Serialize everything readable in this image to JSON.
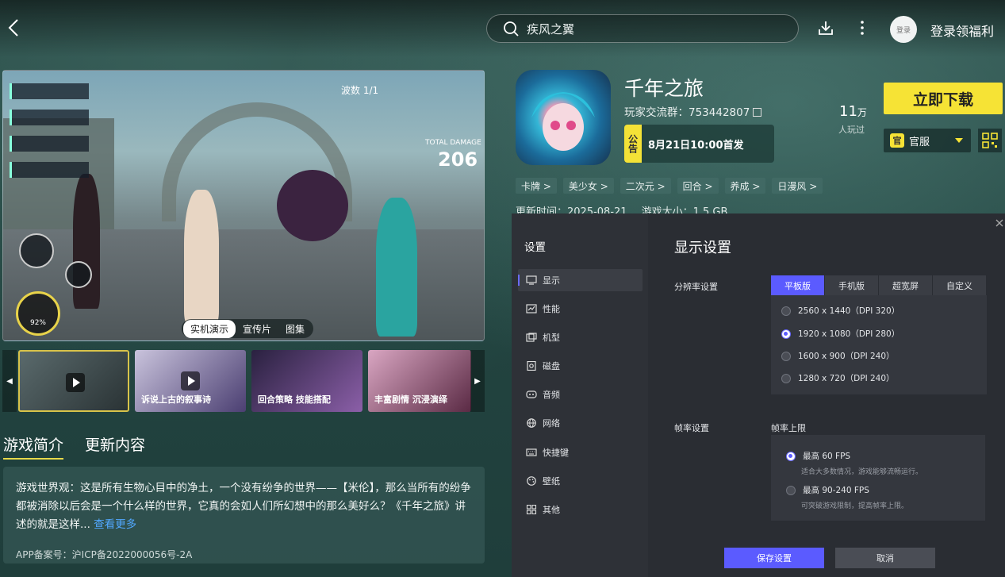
{
  "topbar": {
    "search_placeholder": "疾风之翼",
    "login_avatar": "登录",
    "login_text": "登录领福利"
  },
  "media": {
    "wave_label": "波数",
    "wave_value": "1/1",
    "total_damage_label": "TOTAL DAMAGE",
    "total_damage_value": "206",
    "energy_percent": "92%",
    "tabs": [
      "实机演示",
      "宣传片",
      "图集"
    ],
    "active_tab": 0
  },
  "thumbnails": [
    {
      "caption": "",
      "video": true,
      "selected": true
    },
    {
      "caption": "诉说上古的叙事诗",
      "video": true,
      "selected": false
    },
    {
      "caption": "回合策略 技能搭配",
      "video": false,
      "selected": false
    },
    {
      "caption": "丰富剧情 沉浸演绎",
      "video": false,
      "selected": false
    }
  ],
  "intro": {
    "tabs": [
      "游戏简介",
      "更新内容"
    ],
    "text": "游戏世界观：这是所有生物心目中的净土，一个没有纷争的世界——【米伦】，那么当所有的纷争都被消除以后会是一个什么样的世界，它真的会如人们所幻想中的那么美好么？《千年之旅》讲述的就是这样...",
    "see_more": "查看更多",
    "icp": "APP备案号：沪ICP备2022000056号-2A"
  },
  "game": {
    "title": "千年之旅",
    "group": "玩家交流群：753442807",
    "notice_badge": "公告",
    "notice_text": "8月21日10:00首发",
    "players_num": "11",
    "players_unit": "万",
    "players_label": "人玩过",
    "download_label": "立即下载",
    "server_icon": "官",
    "server_label": "官服",
    "tags": [
      "卡牌 >",
      "美少女 >",
      "二次元 >",
      "回合 >",
      "养成 >",
      "日漫风 >"
    ],
    "update_time": "更新时间：2025-08-21",
    "size": "游戏大小：1.5 GB"
  },
  "settings": {
    "sidebar_title": "设置",
    "nav": [
      {
        "label": "显示",
        "icon": "monitor-icon"
      },
      {
        "label": "性能",
        "icon": "performance-icon"
      },
      {
        "label": "机型",
        "icon": "device-icon"
      },
      {
        "label": "磁盘",
        "icon": "disk-icon"
      },
      {
        "label": "音频",
        "icon": "audio-icon"
      },
      {
        "label": "网络",
        "icon": "network-icon"
      },
      {
        "label": "快捷键",
        "icon": "keyboard-icon"
      },
      {
        "label": "壁纸",
        "icon": "wallpaper-icon"
      },
      {
        "label": "其他",
        "icon": "other-icon"
      }
    ],
    "active_nav": 0,
    "title": "显示设置",
    "resolution_label": "分辨率设置",
    "resolution_tabs": [
      "平板版",
      "手机版",
      "超宽屏",
      "自定义"
    ],
    "active_resolution_tab": 0,
    "resolutions": [
      {
        "label": "2560 x 1440（DPI 320）",
        "selected": false
      },
      {
        "label": "1920 x 1080（DPI 280）",
        "selected": true
      },
      {
        "label": "1600 x 900（DPI 240）",
        "selected": false
      },
      {
        "label": "1280 x 720（DPI 240）",
        "selected": false
      }
    ],
    "fps_label": "帧率设置",
    "fps_limit_label": "帧率上限",
    "fps_options": [
      {
        "label": "最高 60 FPS",
        "desc": "适合大多数情况，游戏能够流畅运行。",
        "selected": true
      },
      {
        "label": "最高 90-240 FPS",
        "desc": "可突破游戏限制，提高帧率上限。",
        "selected": false
      }
    ],
    "save_label": "保存设置",
    "cancel_label": "取消"
  },
  "colors": {
    "accent_yellow": "#f6e335",
    "accent_blue": "#5b5bff",
    "link_blue": "#52a8ff"
  }
}
